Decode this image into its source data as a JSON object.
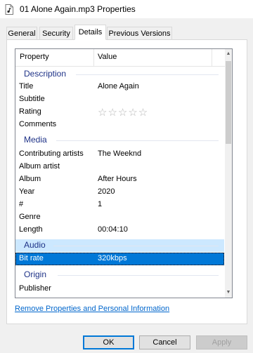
{
  "window": {
    "title": "01 Alone Again.mp3 Properties",
    "icon": "document-icon"
  },
  "tabs": [
    {
      "label": "General",
      "active": false
    },
    {
      "label": "Security",
      "active": false
    },
    {
      "label": "Details",
      "active": true
    },
    {
      "label": "Previous Versions",
      "active": false
    }
  ],
  "list": {
    "columns": {
      "property": "Property",
      "value": "Value"
    },
    "groups": {
      "description": "Description",
      "media": "Media",
      "audio": "Audio",
      "origin": "Origin"
    },
    "rows": {
      "title": {
        "prop": "Title",
        "val": "Alone Again"
      },
      "subtitle": {
        "prop": "Subtitle",
        "val": ""
      },
      "rating": {
        "prop": "Rating",
        "stars": "☆☆☆☆☆",
        "rating_value": 0,
        "rating_max": 5
      },
      "comments": {
        "prop": "Comments",
        "val": ""
      },
      "contributing_artists": {
        "prop": "Contributing artists",
        "val": "The Weeknd"
      },
      "album_artist": {
        "prop": "Album artist",
        "val": ""
      },
      "album": {
        "prop": "Album",
        "val": "After Hours"
      },
      "year": {
        "prop": "Year",
        "val": "2020"
      },
      "track": {
        "prop": "#",
        "val": "1"
      },
      "genre": {
        "prop": "Genre",
        "val": ""
      },
      "length": {
        "prop": "Length",
        "val": "00:04:10"
      },
      "bit_rate": {
        "prop": "Bit rate",
        "val": "320kbps"
      },
      "publisher": {
        "prop": "Publisher",
        "val": ""
      }
    }
  },
  "link": {
    "remove_properties": "Remove Properties and Personal Information"
  },
  "buttons": {
    "ok": "OK",
    "cancel": "Cancel",
    "apply": "Apply"
  },
  "colors": {
    "selection": "#0078d7",
    "group_header": "#1e3287",
    "group_selected": "#cce8ff",
    "link": "#0066cc"
  }
}
